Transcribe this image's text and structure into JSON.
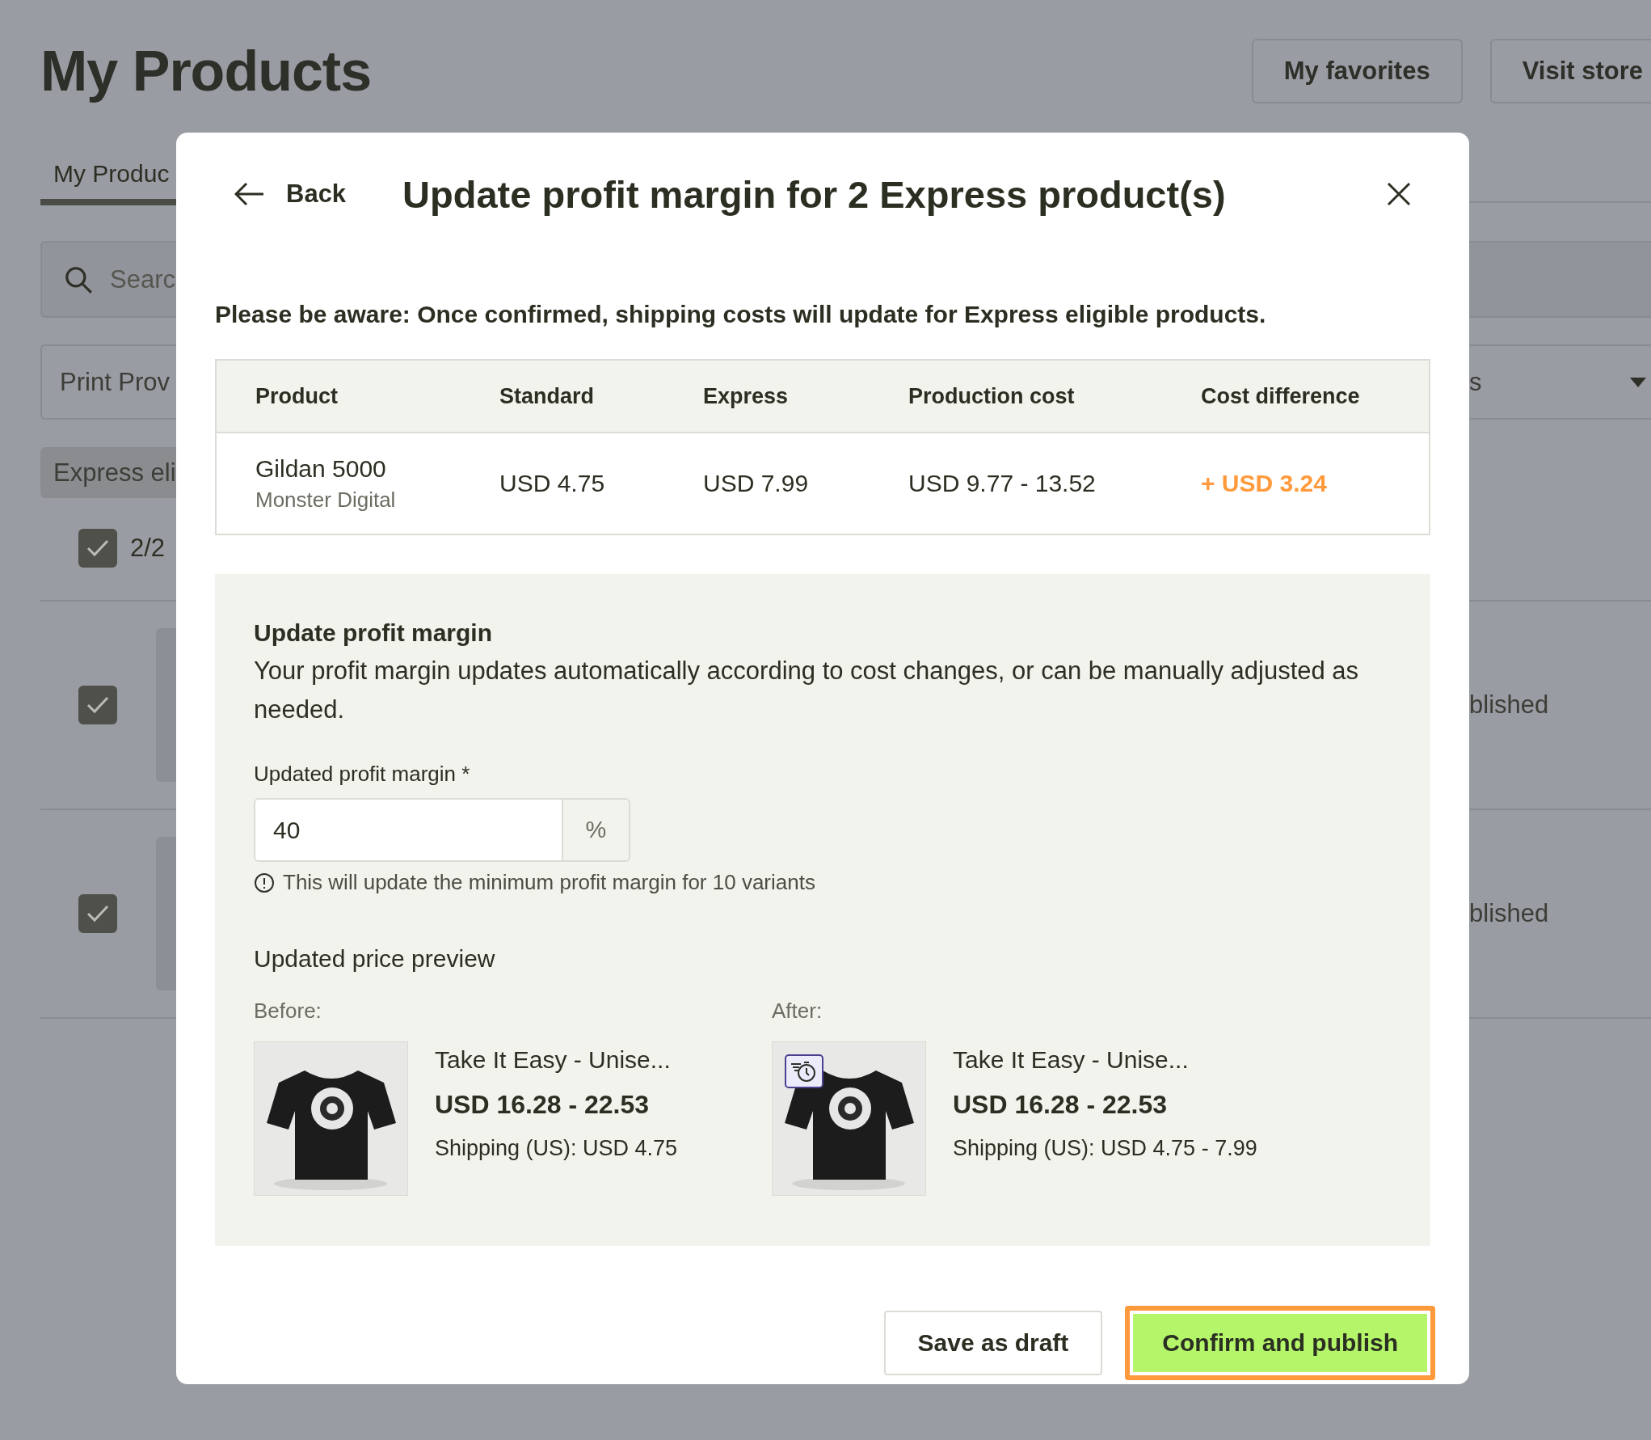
{
  "page": {
    "title": "My Products",
    "header_buttons": [
      "My favorites",
      "Visit store"
    ],
    "tabs": [
      {
        "label": "My Produc",
        "selected": true
      }
    ],
    "search": {
      "placeholder": "Searc"
    },
    "filter": {
      "value": "Print Prov",
      "value_tail": "s"
    },
    "chip": "Express eli",
    "select_all": {
      "checked": true,
      "label": "2/2"
    },
    "rows": [
      {
        "checked": true,
        "status": "blished"
      },
      {
        "checked": true,
        "status": "blished"
      }
    ]
  },
  "modal": {
    "back": "Back",
    "title": "Update profit margin for 2 Express product(s)",
    "warning": "Please be aware: Once confirmed, shipping costs will update for Express eligible products.",
    "table": {
      "columns": [
        "Product",
        "Standard",
        "Express",
        "Production cost",
        "Cost difference"
      ],
      "rows": [
        {
          "product": "Gildan 5000",
          "provider": "Monster Digital",
          "standard": "USD 4.75",
          "express": "USD 7.99",
          "production_cost": "USD 9.77 - 13.52",
          "cost_difference": "+ USD 3.24"
        }
      ]
    },
    "margin": {
      "title": "Update profit margin",
      "description": "Your profit margin updates automatically according to cost changes, or can be manually adjusted as needed.",
      "field_label": "Updated profit margin",
      "required_mark": "*",
      "value": "40",
      "suffix": "%",
      "hint": "This will update the minimum profit margin for 10 variants"
    },
    "preview": {
      "title": "Updated price preview",
      "items": [
        {
          "label": "Before:",
          "name": "Take It Easy - Unise...",
          "price": "USD 16.28 - 22.53",
          "shipping": "Shipping (US): USD 4.75",
          "express_badge": false
        },
        {
          "label": "After:",
          "name": "Take It Easy - Unise...",
          "price": "USD 16.28 - 22.53",
          "shipping": "Shipping (US): USD 4.75 - 7.99",
          "express_badge": true
        }
      ]
    },
    "buttons": [
      {
        "label": "Save as draft",
        "kind": "secondary",
        "highlighted": false
      },
      {
        "label": "Confirm and publish",
        "kind": "primary",
        "highlighted": true
      }
    ]
  }
}
